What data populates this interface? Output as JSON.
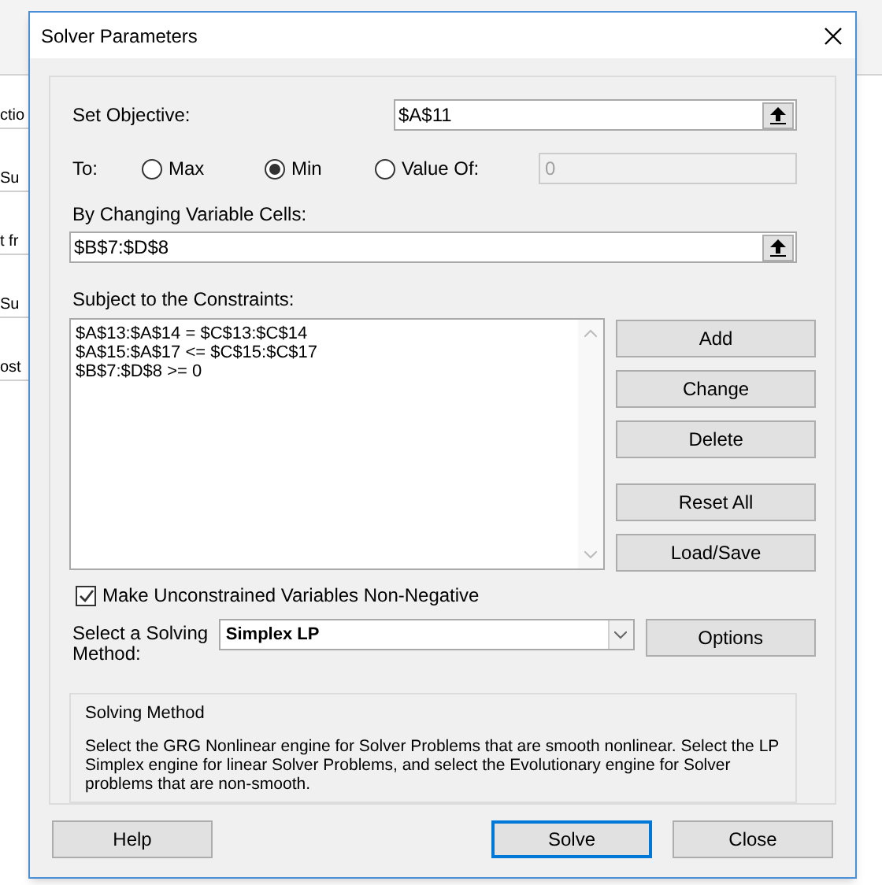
{
  "background": {
    "cell_texts": [
      "ctio",
      "Su",
      "t fr",
      "Su",
      "ost"
    ]
  },
  "window": {
    "title": "Solver Parameters"
  },
  "objective": {
    "label": "Set Objective:",
    "value": "$A$11"
  },
  "to": {
    "label": "To:",
    "options": [
      {
        "label": "Max",
        "selected": false
      },
      {
        "label": "Min",
        "selected": true
      },
      {
        "label": "Value Of:",
        "selected": false
      }
    ],
    "value_field": {
      "value": "0",
      "disabled": true
    }
  },
  "changing_cells": {
    "label": "By Changing Variable Cells:",
    "value": "$B$7:$D$8"
  },
  "constraints": {
    "label": "Subject to the Constraints:",
    "items": [
      "$A$13:$A$14 = $C$13:$C$14",
      "$A$15:$A$17 <= $C$15:$C$17",
      "$B$7:$D$8 >= 0"
    ]
  },
  "constraint_buttons": [
    "Add",
    "Change",
    "Delete",
    "Reset All",
    "Load/Save"
  ],
  "non_negative": {
    "label": "Make Unconstrained Variables Non-Negative",
    "checked": true
  },
  "method": {
    "label": "Select a Solving Method:",
    "value": "Simplex LP",
    "options_button": "Options"
  },
  "description": {
    "title": "Solving Method",
    "text": "Select the GRG Nonlinear engine for Solver Problems that are smooth nonlinear. Select the LP Simplex engine for linear Solver Problems, and select the Evolutionary engine for Solver problems that are non-smooth."
  },
  "buttons": [
    {
      "label": "Help",
      "default": false
    },
    {
      "label": "Solve",
      "default": true
    },
    {
      "label": "Close",
      "default": false
    }
  ]
}
